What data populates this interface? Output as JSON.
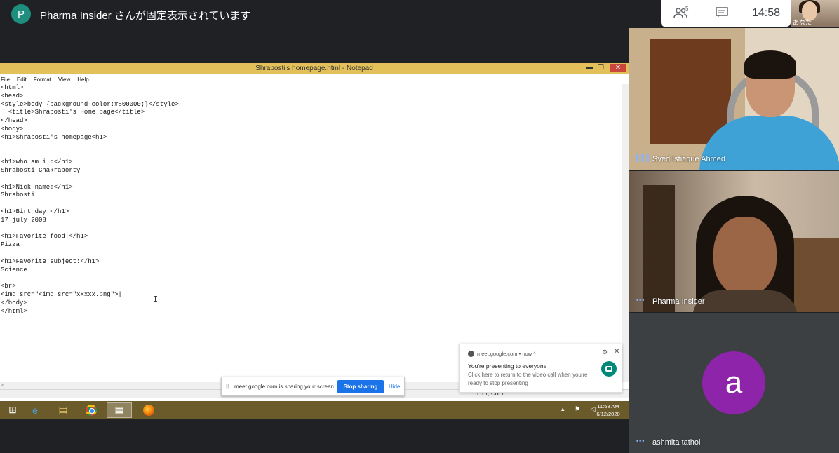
{
  "pinned": {
    "avatar_letter": "P",
    "text": "Pharma Insider さんが固定表示されています"
  },
  "meet_panel": {
    "people_icon": "people-icon",
    "people_count": "5",
    "chat_icon": "chat-icon",
    "time": "14:58",
    "self_label": "あなた"
  },
  "notepad": {
    "title": "Shrabosti's homepage.html - Notepad",
    "min_glyph": "▬",
    "max_glyph": "❐",
    "close_glyph": "✕",
    "menu": [
      "File",
      "Edit",
      "Format",
      "View",
      "Help"
    ],
    "lines": [
      "<html>",
      "<head>",
      "<style>body {background-color:#800000;}</style>",
      "  <title>Shrabosti's Home page</title>",
      "</head>",
      "<body>",
      "<h1>Shrabosti's homepage<h1>",
      "",
      "",
      "<h1>who am i :</h1>",
      "Shrabosti Chakraborty",
      "",
      "<h1>Nick name:</h1>",
      "Shrabosti",
      "",
      "<h1>Birthday:</h1>",
      "17 july 2008",
      "",
      "<h1>Favorite food:</h1>",
      "Pizza",
      "",
      "<h1>Favorite subject:</h1>",
      "Science",
      "",
      "<br>",
      "<img src=\"<img src=\"xxxxx.png\">|",
      "</body>",
      "</html>"
    ],
    "status": "Ln 1, Col 1",
    "hscroll_arrow": "<",
    "ibeam_glyph": "I"
  },
  "share_bar": {
    "grip": "||",
    "text": "meet.google.com is sharing your screen.",
    "stop_label": "Stop sharing",
    "hide_label": "Hide"
  },
  "notification": {
    "source": "meet.google.com  •  now ^",
    "gear_glyph": "⚙",
    "close_glyph": "✕",
    "title": "You're presenting to everyone",
    "body": "Click here to return to the video call when you're ready to stop presenting"
  },
  "taskbar": {
    "start_glyph": "⊞",
    "ie_glyph": "e",
    "files_glyph": "▤",
    "notepad_glyph": "▦",
    "tray_icons": "▴ ⚑ ◁",
    "time": "11:58 AM",
    "date": "6/12/2020"
  },
  "participants": [
    {
      "name": "Syed Istiaque Ahmed",
      "indicator": "▌▌▌"
    },
    {
      "name": "Pharma Insider",
      "indicator": "•••"
    },
    {
      "name": "ashmita tathoi",
      "indicator": "•••",
      "avatar_letter": "a"
    }
  ],
  "colors": {
    "meet_bg": "#202124",
    "accent_blue": "#1a73e8",
    "avatar_purple": "#8e24aa",
    "pin_avatar": "#1e8e7e"
  }
}
